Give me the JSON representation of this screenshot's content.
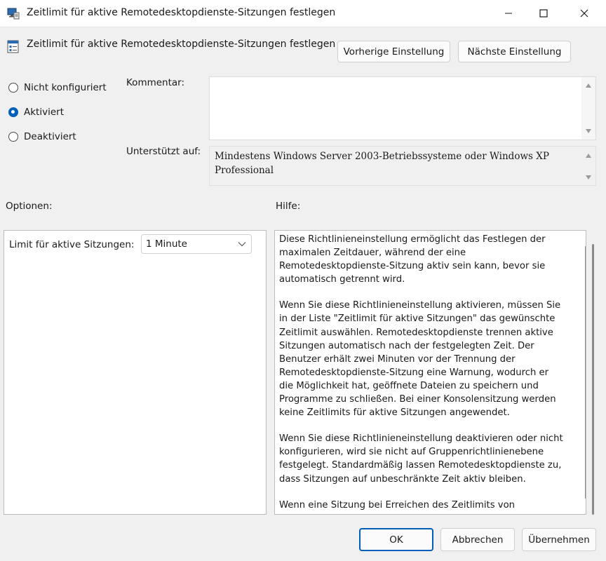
{
  "window": {
    "title": "Zeitlimit für aktive Remotedesktopdienste-Sitzungen festlegen",
    "controls": [
      "minimize",
      "maximize",
      "close"
    ]
  },
  "header": {
    "policy_title": "Zeitlimit für aktive Remotedesktopdienste-Sitzungen festlegen",
    "prev_button": "Vorherige Einstellung",
    "next_button": "Nächste Einstellung"
  },
  "state": {
    "options": [
      {
        "label": "Nicht konfiguriert",
        "checked": false
      },
      {
        "label": "Aktiviert",
        "checked": true
      },
      {
        "label": "Deaktiviert",
        "checked": false
      }
    ]
  },
  "comment": {
    "label": "Kommentar:",
    "value": ""
  },
  "supported": {
    "label": "Unterstützt auf:",
    "value": "Mindestens Windows Server 2003-Betriebssysteme oder Windows XP Professional"
  },
  "sections": {
    "options_label": "Optionen:",
    "help_label": "Hilfe:"
  },
  "options_panel": {
    "limit_label": "Limit für aktive Sitzungen:",
    "limit_value": "1 Minute"
  },
  "help": {
    "paragraphs": [
      "Diese Richtlinieneinstellung ermöglicht das Festlegen der maximalen Zeitdauer, während der eine Remotedesktopdienste-Sitzung aktiv sein kann, bevor sie automatisch getrennt wird.",
      "Wenn Sie diese Richtlinieneinstellung aktivieren, müssen Sie in der Liste \"Zeitlimit für aktive Sitzungen\" das gewünschte Zeitlimit auswählen. Remotedesktopdienste trennen aktive Sitzungen automatisch nach der festgelegten Zeit. Der Benutzer erhält zwei Minuten vor der Trennung der Remotedesktopdienste-Sitzung eine Warnung, wodurch er die Möglichkeit hat, geöffnete Dateien zu speichern und Programme zu schließen. Bei einer Konsolensitzung werden keine Zeitlimits für aktive Sitzungen angewendet.",
      "Wenn Sie diese Richtlinieneinstellung deaktivieren oder nicht konfigurieren, wird sie nicht auf Gruppenrichtlinienebene festgelegt. Standardmäßig lassen Remotedesktopdienste zu, dass Sitzungen auf unbeschränkte Zeit aktiv bleiben.",
      "Wenn eine Sitzung bei Erreichen des Zeitlimits von"
    ]
  },
  "footer": {
    "ok": "OK",
    "cancel": "Abbrechen",
    "apply": "Übernehmen"
  },
  "colors": {
    "accent": "#005fb8",
    "window_bg": "#f0f0f0"
  }
}
